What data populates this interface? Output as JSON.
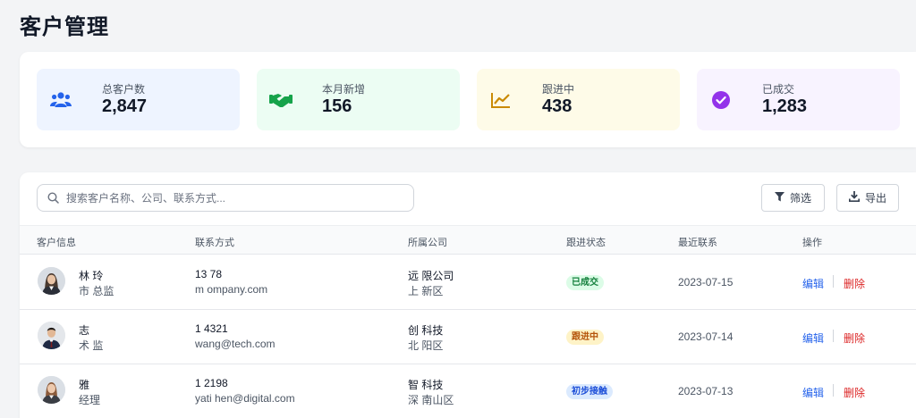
{
  "page": {
    "title": "客户管理"
  },
  "stats": [
    {
      "label": "总客户数",
      "value": "2,847",
      "icon": "users-icon",
      "bg": "#eef4ff",
      "color": "#2563eb"
    },
    {
      "label": "本月新增",
      "value": "156",
      "icon": "handshake-icon",
      "bg": "#ecfdf3",
      "color": "#16a34a"
    },
    {
      "label": "跟进中",
      "value": "438",
      "icon": "chart-line-icon",
      "bg": "#fefbe8",
      "color": "#ca8a04"
    },
    {
      "label": "已成交",
      "value": "1,283",
      "icon": "check-circle-icon",
      "bg": "#f8f3ff",
      "color": "#9333ea"
    }
  ],
  "toolbar": {
    "search_placeholder": "搜索客户名称、公司、联系方式...",
    "filter_label": "筛选",
    "export_label": "导出"
  },
  "table": {
    "columns": [
      "客户信息",
      "联系方式",
      "所属公司",
      "跟进状态",
      "最近联系",
      "操作"
    ],
    "rows": [
      {
        "name": "林 玲",
        "title": "市 总监",
        "phone": "13 78",
        "email": "m ompany.com",
        "company": "远 限公司",
        "district": "上 新区",
        "status": "已成交",
        "status_bg": "#dcfce7",
        "status_color": "#15803d",
        "date": "2023-07-15",
        "edit": "编辑",
        "delete": "删除"
      },
      {
        "name": " 志",
        "title": "术 监",
        "phone": "1 4321",
        "email": " wang@tech.com",
        "company": "创 科技",
        "district": "北 阳区",
        "status": "跟进中",
        "status_bg": "#fef3c7",
        "status_color": "#b45309",
        "date": "2023-07-14",
        "edit": "编辑",
        "delete": "删除"
      },
      {
        "name": " 雅",
        "title": " 经理",
        "phone": "1 2198",
        "email": "yati hen@digital.com",
        "company": "智 科技",
        "district": "深 南山区",
        "status": "初步接触",
        "status_bg": "#dbeafe",
        "status_color": "#1d4ed8",
        "date": "2023-07-13",
        "edit": "编辑",
        "delete": "删除"
      }
    ]
  }
}
